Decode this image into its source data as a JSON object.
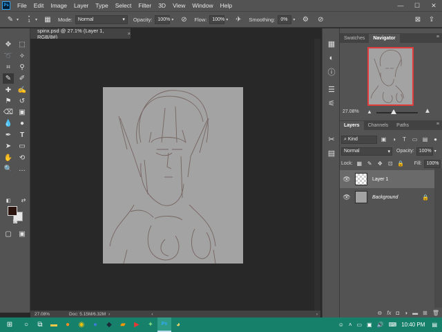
{
  "app": {
    "logo_text": "Ps"
  },
  "menu": [
    "File",
    "Edit",
    "Image",
    "Layer",
    "Type",
    "Select",
    "Filter",
    "3D",
    "View",
    "Window",
    "Help"
  ],
  "window_controls": {
    "minimize": "—",
    "maximize": "☐",
    "close": "✕"
  },
  "options_bar": {
    "mode_label": "Mode:",
    "mode_value": "Normal",
    "opacity_label": "Opacity:",
    "opacity_value": "100%",
    "flow_label": "Flow:",
    "flow_value": "100%",
    "smoothing_label": "Smoothing:",
    "smoothing_value": "0%",
    "brush_size": "1"
  },
  "document": {
    "tab_title": "spinx.psd @ 27.1% (Layer 1, RGB/8#)",
    "tab_close": "×",
    "zoom": "27.08%",
    "doc_info": "Doc: 5.15M/6.32M",
    "canvas_color": "#a3a3a3",
    "sketch_color": "#6e5a55"
  },
  "colors": {
    "foreground": "#2b130e",
    "background": "#e6e6e6"
  },
  "panels": {
    "top_tabs": [
      "Swatches",
      "Navigator"
    ],
    "navigator_zoom": "27.08%",
    "layer_tabs": [
      "Layers",
      "Channels",
      "Paths"
    ],
    "filter_kind": "Kind",
    "blend_mode": "Normal",
    "opacity_label": "Opacity:",
    "opacity_value": "100%",
    "lock_label": "Lock:",
    "fill_label": "Fill:",
    "fill_value": "100%"
  },
  "layers": [
    {
      "name": "Layer 1",
      "selected": true,
      "thumb": "transparent",
      "locked": false
    },
    {
      "name": "Background",
      "selected": false,
      "thumb": "gray",
      "locked": true
    }
  ],
  "taskbar": {
    "clock": "10:40 PM",
    "apps": [
      "search-icon",
      "task-view-icon",
      "file-explorer-icon",
      "firefox-icon",
      "chrome-icon",
      "firefox-nightly-icon",
      "steam-icon",
      "sublime-icon",
      "media-icon",
      "photoshop-icon",
      "app-icon"
    ]
  }
}
